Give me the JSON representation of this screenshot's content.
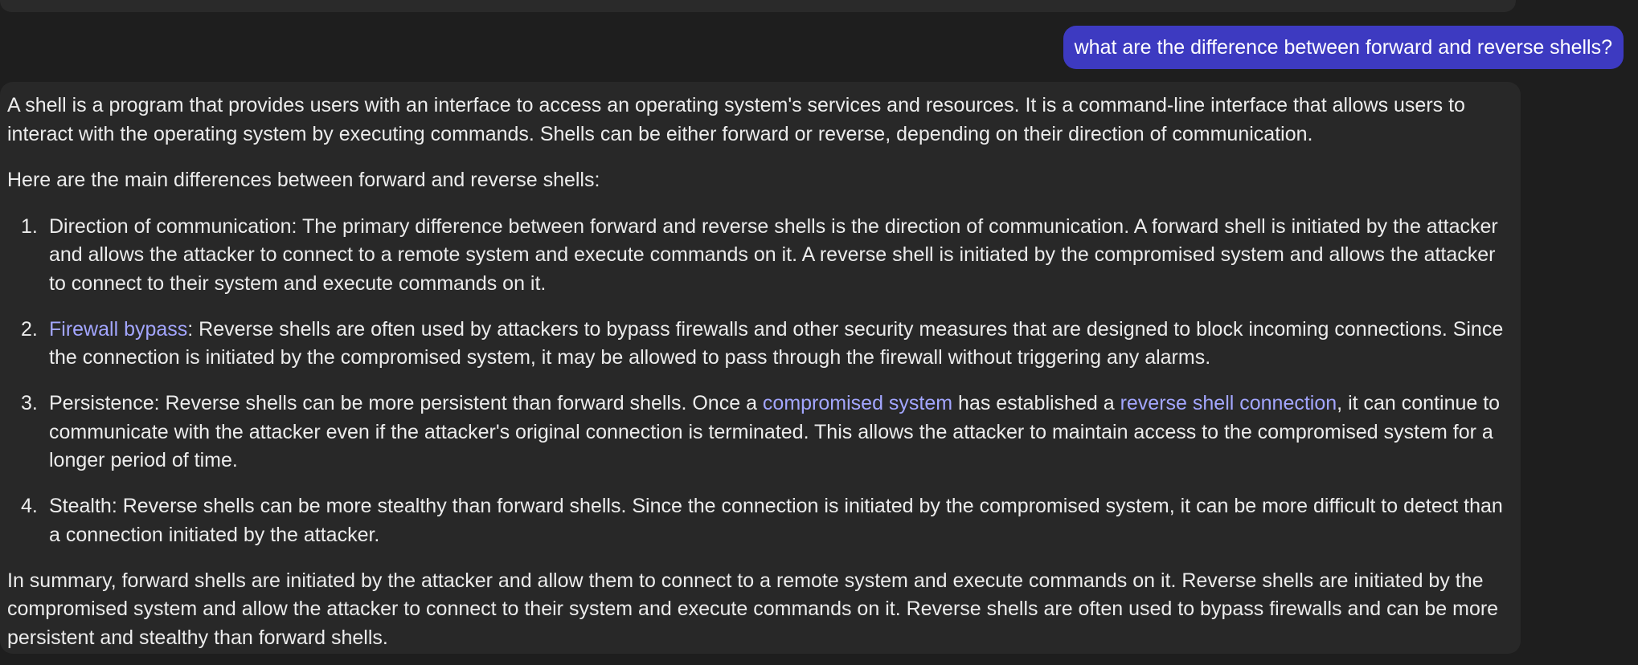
{
  "user_message": "what are the difference between forward and reverse shells?",
  "response": {
    "intro": "A shell is a program that provides users with an interface to access an operating system's services and resources. It is a command-line interface that allows users to interact with the operating system by executing commands. Shells can be either forward or reverse, depending on their direction of communication.",
    "lead": "Here are the main differences between forward and reverse shells:",
    "items": [
      {
        "number": "1.",
        "text": "Direction of communication: The primary difference between forward and reverse shells is the direction of communication. A forward shell is initiated by the attacker and allows the attacker to connect to a remote system and execute commands on it. A reverse shell is initiated by the compromised system and allows the attacker to connect to their system and execute commands on it."
      },
      {
        "number": "2.",
        "link": "Firewall bypass",
        "text": ": Reverse shells are often used by attackers to bypass firewalls and other security measures that are designed to block incoming connections. Since the connection is initiated by the compromised system, it may be allowed to pass through the firewall without triggering any alarms."
      },
      {
        "number": "3.",
        "text_a": "Persistence: Reverse shells can be more persistent than forward shells. Once a ",
        "link_a": "compromised system",
        "text_b": " has established a ",
        "link_b": "reverse shell connection",
        "text_c": ", it can continue to communicate with the attacker even if the attacker's original connection is terminated. This allows the attacker to maintain access to the compromised system for a longer period of time."
      },
      {
        "number": "4.",
        "text": "Stealth: Reverse shells can be more stealthy than forward shells. Since the connection is initiated by the compromised system, it can be more difficult to detect than a connection initiated by the attacker."
      }
    ],
    "summary": "In summary, forward shells are initiated by the attacker and allow them to connect to a remote system and execute commands on it. Reverse shells are initiated by the compromised system and allow the attacker to connect to their system and execute commands on it. Reverse shells are often used to bypass firewalls and can be more persistent and stealthy than forward shells."
  },
  "colors": {
    "background": "#1e1e1e",
    "user_bubble": "#3d3ac1",
    "assistant_bubble": "#282828",
    "link": "#a3a6ff",
    "text": "#ececec"
  }
}
